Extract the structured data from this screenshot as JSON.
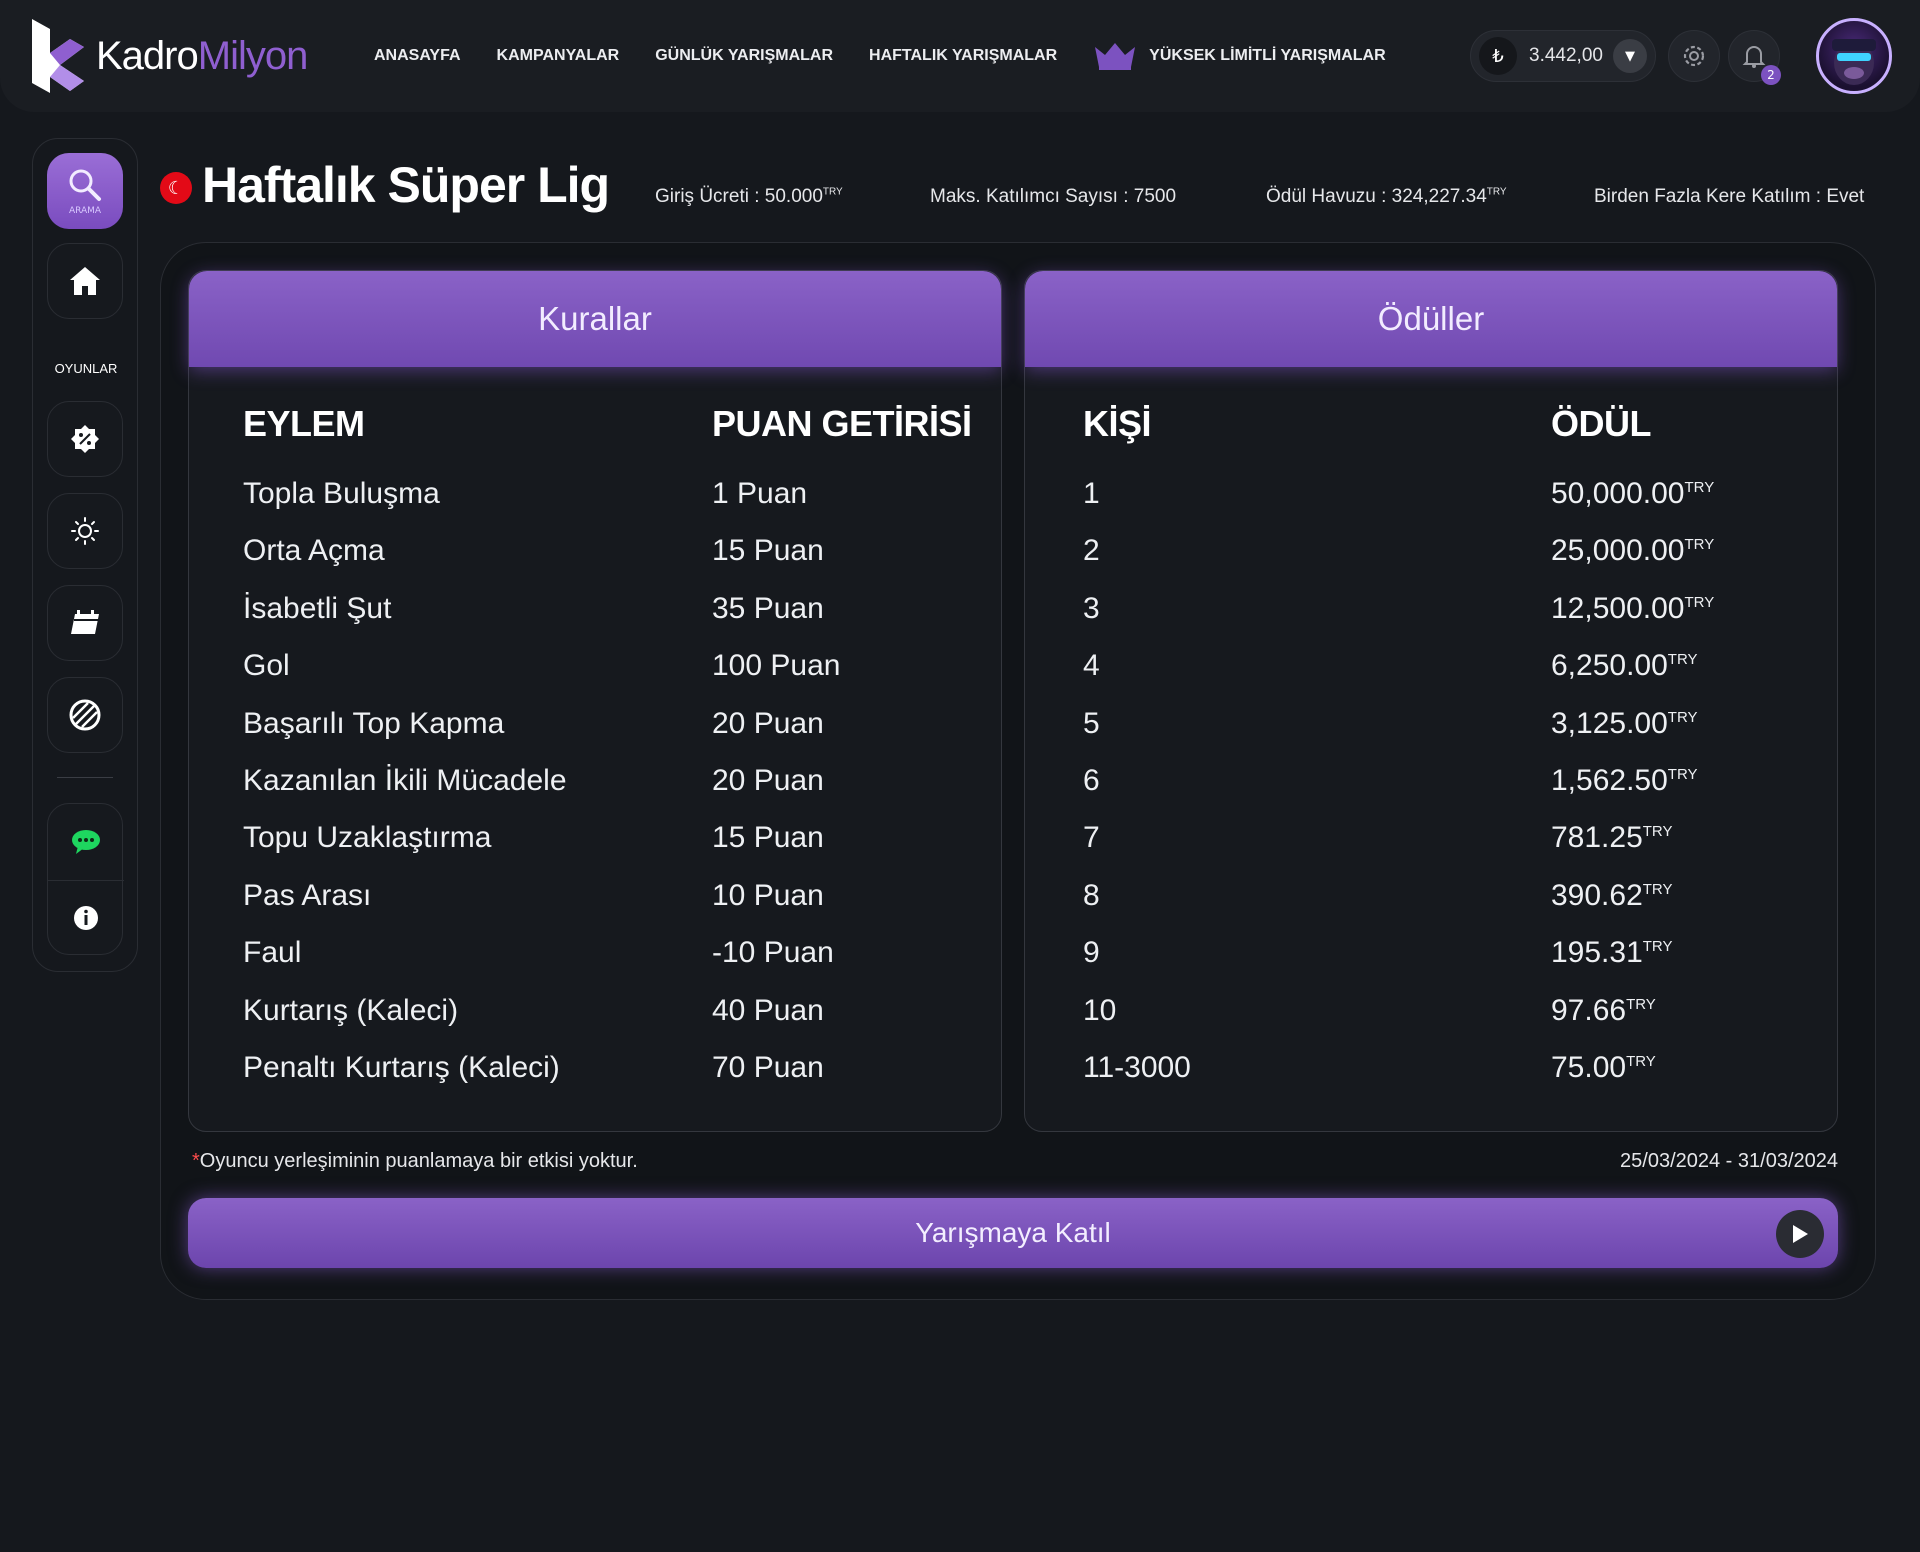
{
  "brand": {
    "part1": "Kadro",
    "part2": "Milyon",
    "accent": "#8f5fd0"
  },
  "nav": {
    "links": [
      "ANASAYFA",
      "KAMPANYALAR",
      "GÜNLÜK YARIŞMALAR",
      "HAFTALIK YARIŞMALAR"
    ],
    "premium": "YÜKSEK LİMİTLİ YARIŞMALAR",
    "balance": "3.442,00",
    "currency_symbol": "₺",
    "notification_count": "2"
  },
  "sidebar": {
    "search_label": "ARAMA",
    "games_label": "OYUNLAR",
    "icons": [
      "search-icon",
      "home-icon",
      "discount-icon",
      "sun-icon",
      "calendar-icon",
      "ball-icon",
      "chat-icon",
      "info-icon"
    ]
  },
  "contest": {
    "title": "Haftalık Süper Lig",
    "entry_fee_label": "Giriş Ücreti : 50.000",
    "max_participants": "Maks. Katılımcı Sayısı : 7500",
    "prize_pool_label": "Ödül Havuzu : 324,227.34",
    "multi_entry": "Birden Fazla Kere Katılım : Evet",
    "currency": "TRY"
  },
  "rules": {
    "header": "Kurallar",
    "col_action": "EYLEM",
    "col_points": "PUAN GETİRİSİ",
    "rows": [
      {
        "action": "Topla Buluşma",
        "points": "1 Puan"
      },
      {
        "action": "Orta Açma",
        "points": "15 Puan"
      },
      {
        "action": "İsabetli Şut",
        "points": "35 Puan"
      },
      {
        "action": "Gol",
        "points": "100 Puan"
      },
      {
        "action": "Başarılı Top Kapma",
        "points": "20 Puan"
      },
      {
        "action": "Kazanılan İkili Mücadele",
        "points": "20 Puan"
      },
      {
        "action": "Topu Uzaklaştırma",
        "points": "15 Puan"
      },
      {
        "action": "Pas Arası",
        "points": "10 Puan"
      },
      {
        "action": "Faul",
        "points": "-10 Puan"
      },
      {
        "action": "Kurtarış (Kaleci)",
        "points": "40 Puan"
      },
      {
        "action": "Penaltı Kurtarış (Kaleci)",
        "points": "70 Puan"
      }
    ]
  },
  "prizes": {
    "header": "Ödüller",
    "col_rank": "KİŞİ",
    "col_prize": "ÖDÜL",
    "rows": [
      {
        "rank": "1",
        "prize": "50,000.00"
      },
      {
        "rank": "2",
        "prize": "25,000.00"
      },
      {
        "rank": "3",
        "prize": "12,500.00"
      },
      {
        "rank": "4",
        "prize": "6,250.00"
      },
      {
        "rank": "5",
        "prize": "3,125.00"
      },
      {
        "rank": "6",
        "prize": "1,562.50"
      },
      {
        "rank": "7",
        "prize": "781.25"
      },
      {
        "rank": "8",
        "prize": "390.62"
      },
      {
        "rank": "9",
        "prize": "195.31"
      },
      {
        "rank": "10",
        "prize": "97.66"
      },
      {
        "rank": "11-3000",
        "prize": "75.00"
      }
    ]
  },
  "footer": {
    "note_asterisk": "*",
    "note": "Oyuncu yerleşiminin puanlamaya bir etkisi yoktur.",
    "dates": "25/03/2024 - 31/03/2024",
    "join_label": "Yarışmaya Katıl"
  }
}
